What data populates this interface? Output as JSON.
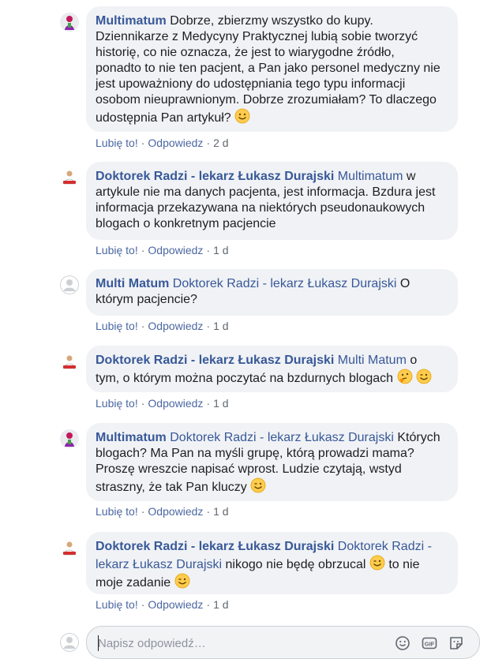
{
  "comments": [
    {
      "author": "Multimatum",
      "mention": "",
      "text_lines": [
        "Dobrze, zbierzmy wszystko do kupy.",
        "Dziennikarze z Medycyny Praktycznej lubią sobie tworzyć",
        "historię, co nie oznacza, że jest to wiarygodne źródło,",
        "ponadto to nie ten pacjent, a Pan jako personel medyczny nie",
        "jest upoważniony do udostępniania tego typu informacji",
        "osobom nieuprawnionym. Dobrze zrozumiałam? To dlaczego",
        "udostępnia Pan artykuł?"
      ],
      "emojis": [
        "smiling-face"
      ],
      "like": "Lubię to!",
      "reply": "Odpowiedz",
      "age": "2 d",
      "avatar": "multimatum-avatar"
    },
    {
      "author": "Doktorek Radzi - lekarz Łukasz Durajski",
      "mention": "Multimatum",
      "text_lines": [
        "w",
        "artykule nie ma danych pacjenta, jest informacja. Bzdura jest",
        "informacja przekazywana na niektórych pseudonaukowych",
        "blogach o konkretnym pacjencie"
      ],
      "emojis": [],
      "like": "Lubię to!",
      "reply": "Odpowiedz",
      "age": "1 d",
      "avatar": "doctor-avatar"
    },
    {
      "author": "Multi Matum",
      "mention": "Doktorek Radzi - lekarz Łukasz Durajski",
      "text_lines": [
        "O",
        "którym pacjencie?"
      ],
      "emojis": [],
      "like": "Lubię to!",
      "reply": "Odpowiedz",
      "age": "1 d",
      "avatar": "default-avatar"
    },
    {
      "author": "Doktorek Radzi - lekarz Łukasz Durajski",
      "mention": "Multi Matum",
      "text_lines": [
        "o",
        "tym, o którym można poczytać na bzdurnych blogach"
      ],
      "emojis": [
        "thinking-face",
        "winking-face"
      ],
      "like": "Lubię to!",
      "reply": "Odpowiedz",
      "age": "1 d",
      "avatar": "doctor-avatar"
    },
    {
      "author": "Multimatum",
      "mention": "Doktorek Radzi - lekarz Łukasz Durajski",
      "text_lines": [
        "Których",
        "blogach? Ma Pan na myśli grupę, którą prowadzi mama?",
        "Proszę wreszcie napisać wprost. Ludzie czytają, wstyd",
        "straszny, że tak Pan kluczy"
      ],
      "emojis": [
        "winking-face"
      ],
      "like": "Lubię to!",
      "reply": "Odpowiedz",
      "age": "1 d",
      "avatar": "multimatum-avatar"
    },
    {
      "author": "Doktorek Radzi - lekarz Łukasz Durajski",
      "mention_line1": "Doktorek Radzi -",
      "mention_line2": "lekarz Łukasz Durajski",
      "text_lines": [
        "nikogo nie będę obrzucal",
        "to nie",
        "moje zadanie"
      ],
      "emojis": [
        "winking-face",
        "winking-face"
      ],
      "like": "Lubię to!",
      "reply": "Odpowiedz",
      "age": "1 d",
      "avatar": "doctor-avatar"
    }
  ],
  "reply_box": {
    "placeholder": "Napisz odpowiedź…",
    "icons": [
      "emoji-icon",
      "gif-icon",
      "sticker-icon"
    ]
  },
  "colors": {
    "author_link": "#385898",
    "bubble_bg": "#f0f2f5",
    "meta_text": "#606770"
  }
}
